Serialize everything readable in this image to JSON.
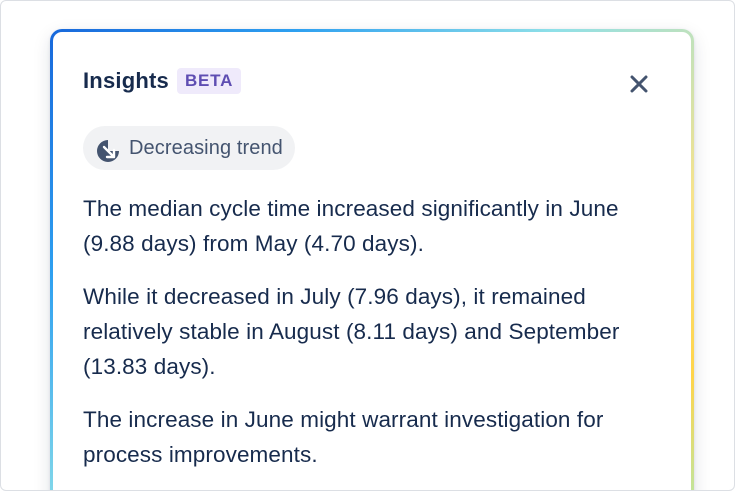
{
  "insights": {
    "title": "Insights",
    "badge": "BETA",
    "close_icon": "close-icon",
    "trend": {
      "icon": "decreasing-trend-icon",
      "label": "Decreasing trend"
    },
    "paragraphs": [
      "The median cycle time increased significantly in June (9.88 days) from May (4.70 days).",
      "While it decreased in July (7.96 days), it remained relatively stable in August (8.11 days) and September (13.83 days).",
      "The increase in June might warrant investigation for process improvements."
    ]
  },
  "colors": {
    "title": "#172b4d",
    "badge_bg": "#efeafb",
    "badge_text": "#5e4db2",
    "chip_bg": "#f1f2f4",
    "chip_text": "#44546f",
    "icon": "#44546f",
    "gradient_start": "#1868db",
    "gradient_end": "#ffd54a"
  }
}
